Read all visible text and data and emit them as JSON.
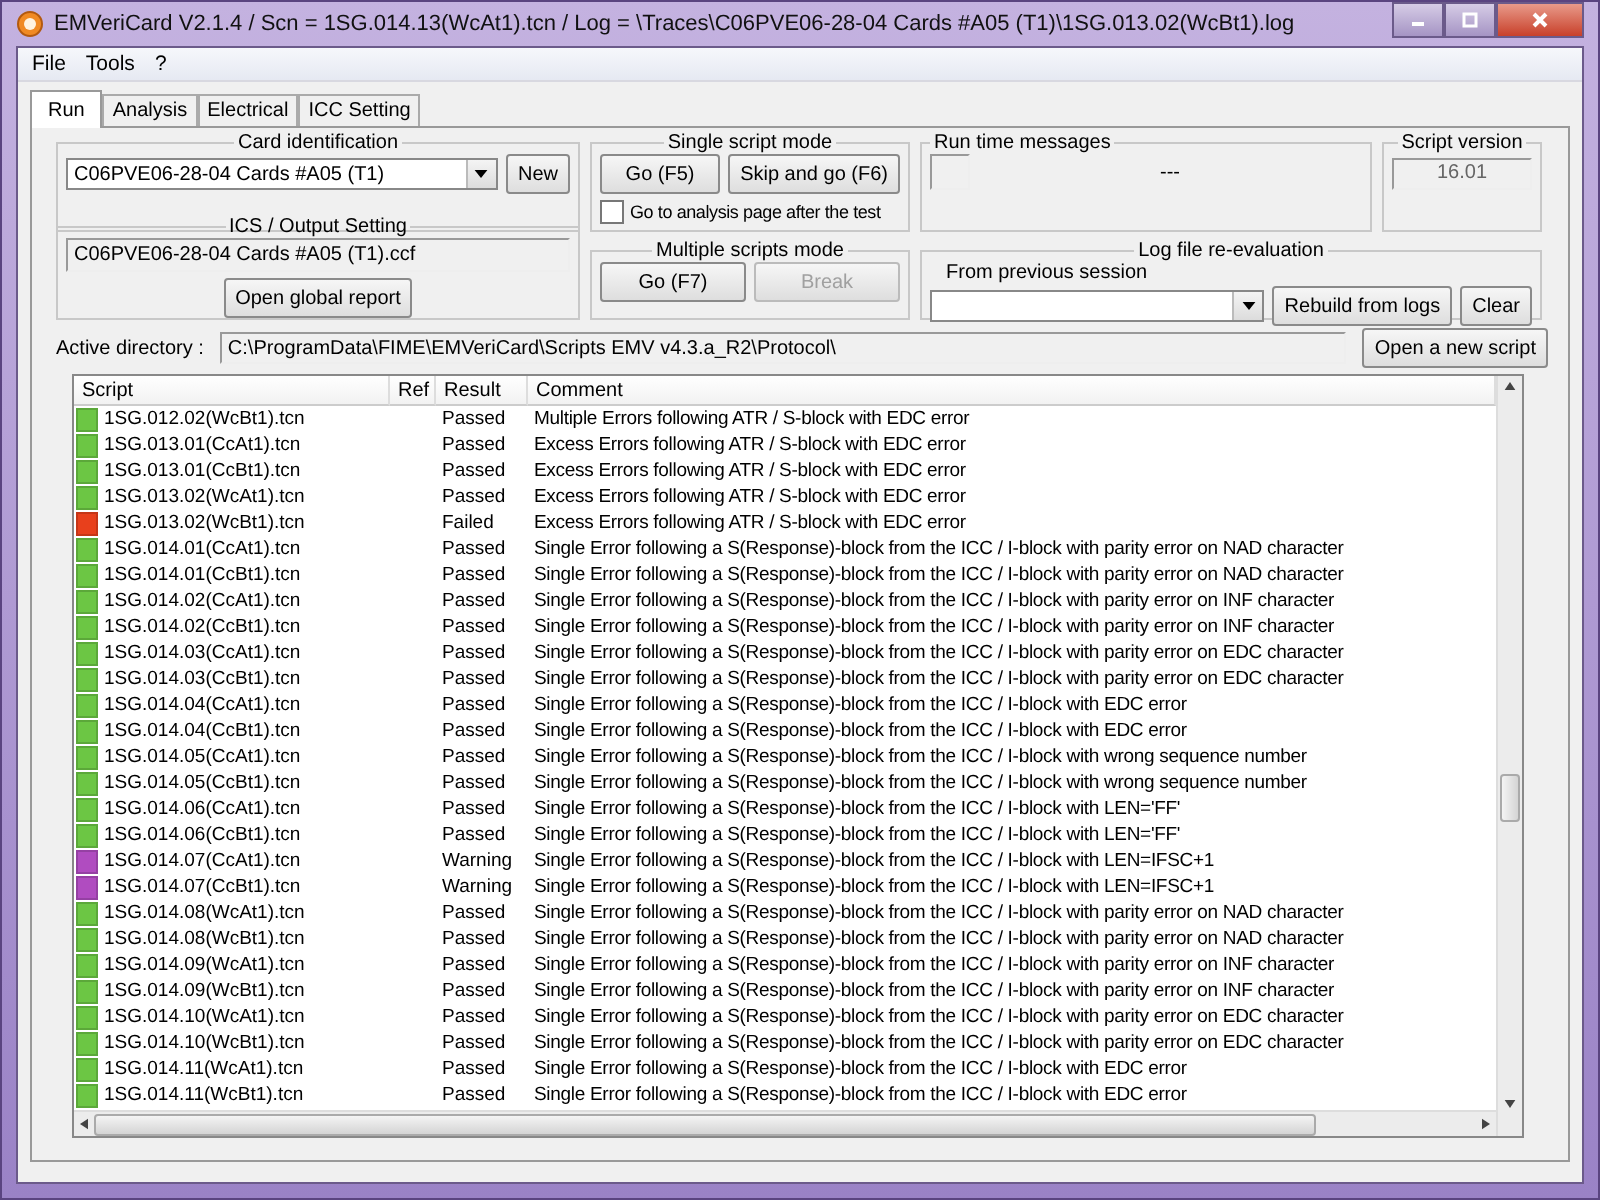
{
  "window": {
    "title": "EMVeriCard V2.1.4 / Scn = 1SG.014.13(WcAt1).tcn / Log = \\Traces\\C06PVE06-28-04 Cards #A05 (T1)\\1SG.013.02(WcBt1).log"
  },
  "menu": [
    "File",
    "Tools",
    "?"
  ],
  "tabs": [
    {
      "label": "Run",
      "selected": true
    },
    {
      "label": "Analysis",
      "selected": false
    },
    {
      "label": "Electrical",
      "selected": false
    },
    {
      "label": "ICC Setting",
      "selected": false
    }
  ],
  "card_identification": {
    "title": "Card identification",
    "value": "C06PVE06-28-04 Cards #A05 (T1)",
    "button": "New"
  },
  "ics_output": {
    "title": "ICS / Output Setting",
    "value": "C06PVE06-28-04 Cards #A05 (T1).ccf",
    "button": "Open global report"
  },
  "single_script": {
    "title": "Single script mode",
    "buttons": [
      {
        "label": "Go (F5)",
        "disabled": false
      },
      {
        "label": "Skip and go (F6)",
        "disabled": false
      }
    ],
    "checkbox": {
      "label": "Go to analysis page after the test",
      "checked": false
    }
  },
  "multiple_scripts": {
    "title": "Multiple scripts mode",
    "buttons": [
      {
        "label": "Go (F7)",
        "disabled": false
      },
      {
        "label": "Break",
        "disabled": true
      }
    ]
  },
  "run_time": {
    "title": "Run time messages",
    "message": "---"
  },
  "script_version": {
    "title": "Script version",
    "value": "16.01"
  },
  "log_reevaluation": {
    "title": "Log file re-evaluation",
    "label": "From previous session",
    "buttons": [
      "Rebuild from logs",
      "Clear"
    ]
  },
  "active_directory": {
    "label": "Active directory :",
    "value": "C:\\ProgramData\\FIME\\EMVeriCard\\Scripts EMV v4.3.a_R2\\Protocol\\",
    "button": "Open a new script"
  },
  "table": {
    "columns": [
      "Script",
      "Ref",
      "Result",
      "Comment"
    ],
    "rows": [
      {
        "script": "1SG.012.02(WcBt1).tcn",
        "result": "Passed",
        "color": "#6cc644",
        "comment": "Multiple Errors following ATR / S-block with EDC error"
      },
      {
        "script": "1SG.013.01(CcAt1).tcn",
        "result": "Passed",
        "color": "#6cc644",
        "comment": "Excess Errors following ATR / S-block with EDC error"
      },
      {
        "script": "1SG.013.01(CcBt1).tcn",
        "result": "Passed",
        "color": "#6cc644",
        "comment": "Excess Errors following ATR / S-block with EDC error"
      },
      {
        "script": "1SG.013.02(WcAt1).tcn",
        "result": "Passed",
        "color": "#6cc644",
        "comment": "Excess Errors following ATR / S-block with EDC error"
      },
      {
        "script": "1SG.013.02(WcBt1).tcn",
        "result": "Failed",
        "color": "#e8401c",
        "comment": "Excess Errors following ATR / S-block with EDC error"
      },
      {
        "script": "1SG.014.01(CcAt1).tcn",
        "result": "Passed",
        "color": "#6cc644",
        "comment": "Single Error following a S(Response)-block from the ICC / I-block with parity error on NAD character"
      },
      {
        "script": "1SG.014.01(CcBt1).tcn",
        "result": "Passed",
        "color": "#6cc644",
        "comment": "Single Error following a S(Response)-block from the ICC / I-block with parity error on NAD character"
      },
      {
        "script": "1SG.014.02(CcAt1).tcn",
        "result": "Passed",
        "color": "#6cc644",
        "comment": "Single Error following a S(Response)-block from the ICC / I-block with parity error on INF character"
      },
      {
        "script": "1SG.014.02(CcBt1).tcn",
        "result": "Passed",
        "color": "#6cc644",
        "comment": "Single Error following a S(Response)-block from the ICC / I-block with parity error on INF character"
      },
      {
        "script": "1SG.014.03(CcAt1).tcn",
        "result": "Passed",
        "color": "#6cc644",
        "comment": "Single Error following a S(Response)-block from the ICC / I-block with parity error on EDC character"
      },
      {
        "script": "1SG.014.03(CcBt1).tcn",
        "result": "Passed",
        "color": "#6cc644",
        "comment": "Single Error following a S(Response)-block from the ICC / I-block with parity error on EDC character"
      },
      {
        "script": "1SG.014.04(CcAt1).tcn",
        "result": "Passed",
        "color": "#6cc644",
        "comment": "Single Error following a S(Response)-block from the ICC / I-block with EDC error"
      },
      {
        "script": "1SG.014.04(CcBt1).tcn",
        "result": "Passed",
        "color": "#6cc644",
        "comment": "Single Error following a S(Response)-block from the ICC / I-block with EDC error"
      },
      {
        "script": "1SG.014.05(CcAt1).tcn",
        "result": "Passed",
        "color": "#6cc644",
        "comment": "Single Error following a S(Response)-block from the ICC / I-block with wrong sequence number"
      },
      {
        "script": "1SG.014.05(CcBt1).tcn",
        "result": "Passed",
        "color": "#6cc644",
        "comment": "Single Error following a S(Response)-block from the ICC / I-block with wrong sequence number"
      },
      {
        "script": "1SG.014.06(CcAt1).tcn",
        "result": "Passed",
        "color": "#6cc644",
        "comment": "Single Error following a S(Response)-block from the ICC / I-block with LEN='FF'"
      },
      {
        "script": "1SG.014.06(CcBt1).tcn",
        "result": "Passed",
        "color": "#6cc644",
        "comment": "Single Error following a S(Response)-block from the ICC / I-block with LEN='FF'"
      },
      {
        "script": "1SG.014.07(CcAt1).tcn",
        "result": "Warning",
        "color": "#b04cc0",
        "comment": "Single Error following a S(Response)-block from the ICC / I-block with LEN=IFSC+1"
      },
      {
        "script": "1SG.014.07(CcBt1).tcn",
        "result": "Warning",
        "color": "#b04cc0",
        "comment": "Single Error following a S(Response)-block from the ICC / I-block with LEN=IFSC+1"
      },
      {
        "script": "1SG.014.08(WcAt1).tcn",
        "result": "Passed",
        "color": "#6cc644",
        "comment": "Single Error following a S(Response)-block from the ICC / I-block with parity error on NAD character"
      },
      {
        "script": "1SG.014.08(WcBt1).tcn",
        "result": "Passed",
        "color": "#6cc644",
        "comment": "Single Error following a S(Response)-block from the ICC / I-block with parity error on NAD character"
      },
      {
        "script": "1SG.014.09(WcAt1).tcn",
        "result": "Passed",
        "color": "#6cc644",
        "comment": "Single Error following a S(Response)-block from the ICC / I-block with parity error on INF character"
      },
      {
        "script": "1SG.014.09(WcBt1).tcn",
        "result": "Passed",
        "color": "#6cc644",
        "comment": "Single Error following a S(Response)-block from the ICC / I-block with parity error on INF character"
      },
      {
        "script": "1SG.014.10(WcAt1).tcn",
        "result": "Passed",
        "color": "#6cc644",
        "comment": "Single Error following a S(Response)-block from the ICC / I-block with parity error on EDC character"
      },
      {
        "script": "1SG.014.10(WcBt1).tcn",
        "result": "Passed",
        "color": "#6cc644",
        "comment": "Single Error following a S(Response)-block from the ICC / I-block with parity error on EDC character"
      },
      {
        "script": "1SG.014.11(WcAt1).tcn",
        "result": "Passed",
        "color": "#6cc644",
        "comment": "Single Error following a S(Response)-block from the ICC / I-block with EDC error"
      },
      {
        "script": "1SG.014.11(WcBt1).tcn",
        "result": "Passed",
        "color": "#6cc644",
        "comment": "Single Error following a S(Response)-block from the ICC / I-block with EDC error"
      }
    ]
  }
}
